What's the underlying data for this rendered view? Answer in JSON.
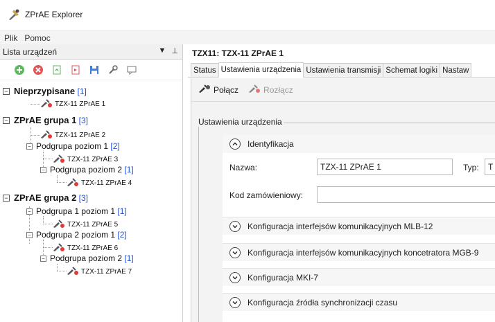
{
  "window": {
    "title": "ZPrAE Explorer"
  },
  "menu": {
    "items": [
      "Plik",
      "Pomoc"
    ]
  },
  "left": {
    "header": "Lista urządzeń",
    "dropdown_glyph": "▼",
    "pin_glyph": "⊥",
    "toolbar_icons": [
      "add-icon",
      "remove-icon",
      "refresh-icon",
      "export-icon",
      "save-icon",
      "connect-icon",
      "comment-icon"
    ],
    "tree": {
      "g0": {
        "name": "Nieprzypisane",
        "count": "[1]",
        "dev1": "TZX-11 ZPrAE 1"
      },
      "g1": {
        "name": "ZPrAE grupa 1",
        "count": "[3]",
        "dev2": "TZX-11 ZPrAE 2",
        "sub1": {
          "name": "Podgrupa poziom 1",
          "count": "[2]",
          "dev3": "TZX-11 ZPrAE 3"
        },
        "sub2": {
          "name": "Podgrupa poziom 2",
          "count": "[1]",
          "dev4": "TZX-11 ZPrAE 4"
        }
      },
      "g2": {
        "name": "ZPrAE grupa 2",
        "count": "[3]",
        "sub1": {
          "name": "Podgrupa 1 poziom 1",
          "count": "[1]",
          "dev5": "TZX-11 ZPrAE 5"
        },
        "sub2": {
          "name": "Podgrupa 2 poziom 1",
          "count": "[2]",
          "dev6": "TZX-11 ZPrAE 6"
        },
        "sub3": {
          "name": "Podgrupa poziom 2",
          "count": "[1]",
          "dev7": "TZX-11 ZPrAE 7"
        }
      }
    }
  },
  "right": {
    "title": "TZX11: TZX-11 ZPrAE 1",
    "tabs": [
      "Status",
      "Ustawienia urządzenia",
      "Ustawienia transmisji",
      "Schemat logiki",
      "Nastaw"
    ],
    "active_tab": "Ustawienia urządzenia",
    "actions": {
      "connect": "Połącz",
      "disconnect": "Rozłącz"
    },
    "groupbox": "Ustawienia urządzenia",
    "sections": {
      "ident": "Identyfikacja",
      "s1": "Konfiguracja interfejsów komunikacyjnych MLB-12",
      "s2": "Konfiguracja interfejsów komunikacyjnych koncetratora MGB-9",
      "s3": "Konfiguracja MKI-7",
      "s4": "Konfiguracja źródła synchronizacji czasu"
    },
    "fields": {
      "name_label": "Nazwa:",
      "name_value": "TZX-11 ZPrAE 1",
      "type_label": "Typ:",
      "type_value": "T",
      "order_label": "Kod zamówieniowy:",
      "order_value": ""
    }
  },
  "colors": {
    "count_blue": "#1f4fd8",
    "panel_bg": "#f3f3f3"
  }
}
